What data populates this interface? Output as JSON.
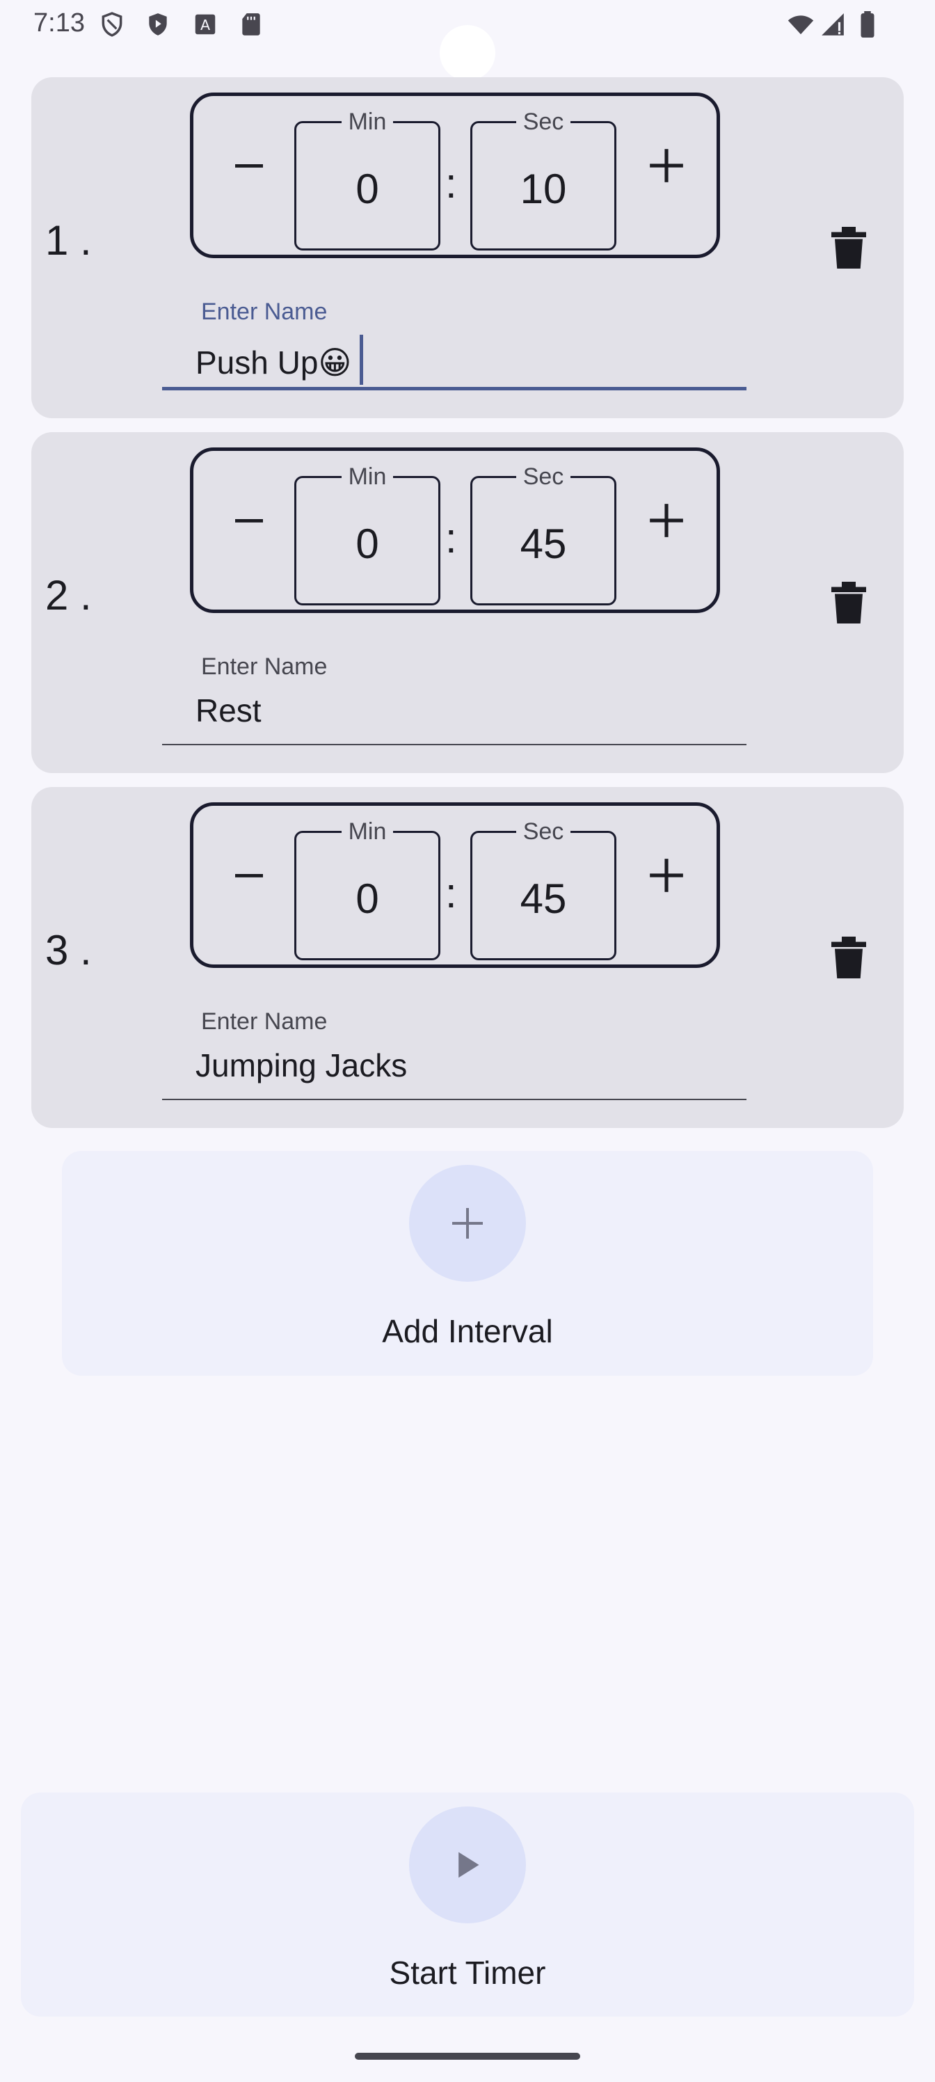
{
  "status_bar": {
    "time": "7:13",
    "left_icons": [
      "shield-outline-icon",
      "shield-play-icon",
      "text-a-icon",
      "sd-card-icon"
    ],
    "right_icons": [
      "wifi-icon",
      "signal-icon",
      "battery-icon"
    ]
  },
  "intervals": [
    {
      "index": "1 .",
      "min_label": "Min",
      "min_value": "0",
      "sec_label": "Sec",
      "sec_value": "10",
      "name_label": "Enter Name",
      "name_value": "Push Up😀",
      "focused": true
    },
    {
      "index": "2 .",
      "min_label": "Min",
      "min_value": "0",
      "sec_label": "Sec",
      "sec_value": "45",
      "name_label": "Enter Name",
      "name_value": "Rest",
      "focused": false
    },
    {
      "index": "3 .",
      "min_label": "Min",
      "min_value": "0",
      "sec_label": "Sec",
      "sec_value": "45",
      "name_label": "Enter Name",
      "name_value": "Jumping Jacks",
      "focused": false
    }
  ],
  "separator": ":",
  "add_interval": {
    "label": "Add Interval"
  },
  "start_timer": {
    "label": "Start Timer"
  },
  "colors": {
    "background": "#f7f6fc",
    "card": "#e2e1e8",
    "accent": "#4a5b92",
    "action_card": "#eff0fb",
    "action_circle": "#dce1f9"
  }
}
